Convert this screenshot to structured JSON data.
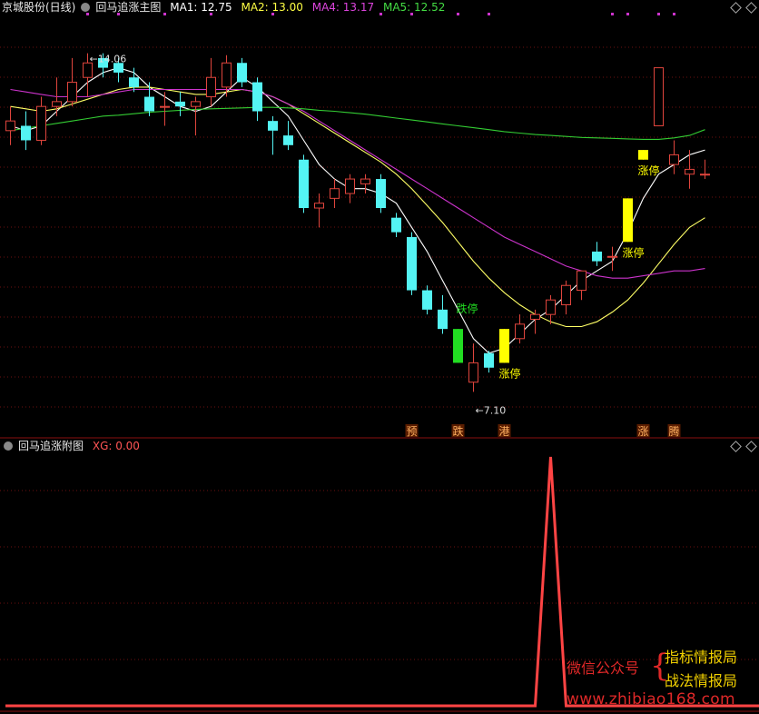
{
  "header": {
    "stock_name": "京城股份(日线)",
    "indicator_name": "回马追涨主图",
    "ma1": "MA1: 12.75",
    "ma2": "MA2: 13.00",
    "ma4": "MA4: 13.17",
    "ma5": "MA5: 12.52"
  },
  "sub_header": {
    "indicator_name": "回马追涨附图",
    "xg": "XG: 0.00"
  },
  "colors": {
    "up": "#e0453d",
    "down": "#54f4f4",
    "limit_up": "#ffff00",
    "limit_down": "#22dd22",
    "ma1": "#ffffff",
    "ma2": "#ffff66",
    "ma4": "#cc33cc",
    "ma5": "#33cc33",
    "grid": "#6b0f0f",
    "xg": "#ff4444"
  },
  "watermark": {
    "left": "微信公众号",
    "right_top": "指标情报局",
    "right_bottom": "战法情报局",
    "url": "www.zhibiao168.com"
  },
  "chart_data": {
    "type": "candlestick",
    "price_range": [
      6.6,
      14.9
    ],
    "annotations": {
      "high_label": "14.06",
      "low_label": "7.10",
      "limit_up": "涨停",
      "limit_down": "跌停"
    },
    "candles": [
      {
        "o": 12.5,
        "h": 13.0,
        "l": 12.2,
        "c": 12.7
      },
      {
        "o": 12.6,
        "h": 12.9,
        "l": 12.1,
        "c": 12.3
      },
      {
        "o": 12.3,
        "h": 13.2,
        "l": 12.2,
        "c": 13.0
      },
      {
        "o": 13.0,
        "h": 13.6,
        "l": 12.8,
        "c": 13.1
      },
      {
        "o": 13.1,
        "h": 14.0,
        "l": 13.0,
        "c": 13.5
      },
      {
        "o": 13.6,
        "h": 14.1,
        "l": 13.2,
        "c": 13.9
      },
      {
        "o": 14.0,
        "h": 14.1,
        "l": 13.6,
        "c": 13.8
      },
      {
        "o": 13.9,
        "h": 14.0,
        "l": 13.5,
        "c": 13.7
      },
      {
        "o": 13.6,
        "h": 13.8,
        "l": 13.3,
        "c": 13.4
      },
      {
        "o": 13.2,
        "h": 13.5,
        "l": 12.8,
        "c": 12.9
      },
      {
        "o": 13.0,
        "h": 13.3,
        "l": 12.6,
        "c": 13.0
      },
      {
        "o": 13.1,
        "h": 13.3,
        "l": 12.8,
        "c": 13.0
      },
      {
        "o": 13.0,
        "h": 13.2,
        "l": 12.4,
        "c": 13.1
      },
      {
        "o": 13.2,
        "h": 14.0,
        "l": 13.0,
        "c": 13.6
      },
      {
        "o": 13.4,
        "h": 14.06,
        "l": 13.2,
        "c": 13.9
      },
      {
        "o": 13.9,
        "h": 14.0,
        "l": 13.4,
        "c": 13.5
      },
      {
        "o": 13.5,
        "h": 13.6,
        "l": 12.7,
        "c": 12.9
      },
      {
        "o": 12.7,
        "h": 12.8,
        "l": 12.0,
        "c": 12.5
      },
      {
        "o": 12.4,
        "h": 12.7,
        "l": 12.1,
        "c": 12.2
      },
      {
        "o": 11.9,
        "h": 12.0,
        "l": 10.8,
        "c": 10.9
      },
      {
        "o": 10.9,
        "h": 11.2,
        "l": 10.5,
        "c": 11.0
      },
      {
        "o": 11.1,
        "h": 11.5,
        "l": 10.9,
        "c": 11.3
      },
      {
        "o": 11.2,
        "h": 11.6,
        "l": 11.0,
        "c": 11.5
      },
      {
        "o": 11.4,
        "h": 11.6,
        "l": 11.2,
        "c": 11.5
      },
      {
        "o": 11.5,
        "h": 11.6,
        "l": 10.8,
        "c": 10.9
      },
      {
        "o": 10.7,
        "h": 10.8,
        "l": 10.3,
        "c": 10.4
      },
      {
        "o": 10.3,
        "h": 10.4,
        "l": 9.1,
        "c": 9.2
      },
      {
        "o": 9.2,
        "h": 9.3,
        "l": 8.7,
        "c": 8.8
      },
      {
        "o": 8.8,
        "h": 9.1,
        "l": 8.3,
        "c": 8.4
      },
      {
        "o": 8.4,
        "h": 8.4,
        "l": 7.7,
        "c": 7.7,
        "limit": "down"
      },
      {
        "o": 7.3,
        "h": 8.1,
        "l": 7.1,
        "c": 7.7
      },
      {
        "o": 7.9,
        "h": 7.95,
        "l": 7.5,
        "c": 7.6
      },
      {
        "o": 7.7,
        "h": 8.4,
        "l": 7.7,
        "c": 8.4,
        "limit": "up"
      },
      {
        "o": 8.2,
        "h": 8.7,
        "l": 8.1,
        "c": 8.5
      },
      {
        "o": 8.6,
        "h": 8.8,
        "l": 8.3,
        "c": 8.7
      },
      {
        "o": 8.7,
        "h": 9.1,
        "l": 8.5,
        "c": 9.0
      },
      {
        "o": 8.9,
        "h": 9.4,
        "l": 8.7,
        "c": 9.3
      },
      {
        "o": 9.2,
        "h": 9.6,
        "l": 9.0,
        "c": 9.6
      },
      {
        "o": 10.0,
        "h": 10.2,
        "l": 9.7,
        "c": 9.8
      },
      {
        "o": 9.9,
        "h": 10.1,
        "l": 9.6,
        "c": 9.9
      },
      {
        "o": 10.2,
        "h": 11.1,
        "l": 10.2,
        "c": 11.1,
        "limit": "up"
      },
      {
        "o": 11.9,
        "h": 12.1,
        "l": 11.9,
        "c": 12.1,
        "limit": "up"
      },
      {
        "o": 12.6,
        "h": 13.8,
        "l": 12.6,
        "c": 13.8
      },
      {
        "o": 11.8,
        "h": 12.3,
        "l": 11.6,
        "c": 12.0
      },
      {
        "o": 11.6,
        "h": 12.1,
        "l": 11.3,
        "c": 11.7
      },
      {
        "o": 11.6,
        "h": 11.9,
        "l": 11.5,
        "c": 11.6
      }
    ],
    "limit_labels": [
      {
        "index": 29,
        "text": "跌停"
      },
      {
        "index": 32,
        "text": "涨停"
      },
      {
        "index": 40,
        "text": "涨停"
      },
      {
        "index": 41,
        "text": "涨停"
      }
    ],
    "markers": [
      {
        "index": 26,
        "text": "预"
      },
      {
        "index": 29,
        "text": "跌"
      },
      {
        "index": 32,
        "text": "港"
      },
      {
        "index": 41,
        "text": "涨"
      },
      {
        "index": 43,
        "text": "腾"
      }
    ],
    "series": [
      {
        "key": "ma1",
        "values": [
          12.6,
          12.5,
          12.6,
          12.9,
          13.2,
          13.5,
          13.7,
          13.8,
          13.7,
          13.4,
          13.2,
          13.0,
          12.9,
          13.0,
          13.3,
          13.6,
          13.4,
          13.1,
          12.8,
          12.3,
          11.8,
          11.5,
          11.3,
          11.3,
          11.2,
          11.0,
          10.5,
          10.0,
          9.4,
          8.8,
          8.2,
          7.9,
          8.0,
          8.3,
          8.6,
          8.8,
          9.1,
          9.4,
          9.6,
          9.8,
          10.4,
          11.1,
          11.6,
          11.8,
          12.0,
          12.1
        ]
      },
      {
        "key": "ma2",
        "values": [
          13.0,
          12.95,
          12.9,
          12.95,
          13.05,
          13.15,
          13.25,
          13.35,
          13.4,
          13.4,
          13.35,
          13.3,
          13.25,
          13.25,
          13.3,
          13.35,
          13.3,
          13.2,
          13.05,
          12.85,
          12.65,
          12.45,
          12.25,
          12.05,
          11.85,
          11.6,
          11.3,
          10.95,
          10.6,
          10.2,
          9.8,
          9.45,
          9.15,
          8.9,
          8.7,
          8.55,
          8.45,
          8.45,
          8.55,
          8.75,
          9.0,
          9.35,
          9.75,
          10.15,
          10.5,
          10.7
        ]
      },
      {
        "key": "ma4",
        "values": [
          13.35,
          13.3,
          13.25,
          13.2,
          13.2,
          13.2,
          13.25,
          13.3,
          13.35,
          13.35,
          13.35,
          13.35,
          13.35,
          13.35,
          13.35,
          13.35,
          13.3,
          13.2,
          13.05,
          12.9,
          12.7,
          12.5,
          12.3,
          12.1,
          11.9,
          11.7,
          11.5,
          11.3,
          11.1,
          10.9,
          10.7,
          10.5,
          10.3,
          10.15,
          10.0,
          9.85,
          9.7,
          9.6,
          9.5,
          9.45,
          9.45,
          9.5,
          9.55,
          9.6,
          9.6,
          9.65
        ]
      },
      {
        "key": "ma5",
        "values": [
          12.5,
          12.55,
          12.6,
          12.65,
          12.7,
          12.75,
          12.8,
          12.82,
          12.85,
          12.88,
          12.9,
          12.92,
          12.94,
          12.95,
          12.96,
          12.97,
          12.98,
          12.98,
          12.97,
          12.95,
          12.92,
          12.9,
          12.87,
          12.84,
          12.8,
          12.76,
          12.72,
          12.68,
          12.64,
          12.6,
          12.56,
          12.52,
          12.48,
          12.45,
          12.42,
          12.4,
          12.38,
          12.36,
          12.35,
          12.34,
          12.33,
          12.32,
          12.32,
          12.35,
          12.4,
          12.52
        ]
      }
    ],
    "xg": {
      "range": [
        0,
        1
      ],
      "values": [
        0,
        0,
        0,
        0,
        0,
        0,
        0,
        0,
        0,
        0,
        0,
        0,
        0,
        0,
        0,
        0,
        0,
        0,
        0,
        0,
        0,
        0,
        0,
        0,
        0,
        0,
        0,
        0,
        0,
        0,
        0,
        0,
        0,
        0,
        0,
        1,
        0,
        0,
        0,
        0,
        0,
        0,
        0,
        0,
        0,
        0
      ]
    }
  }
}
